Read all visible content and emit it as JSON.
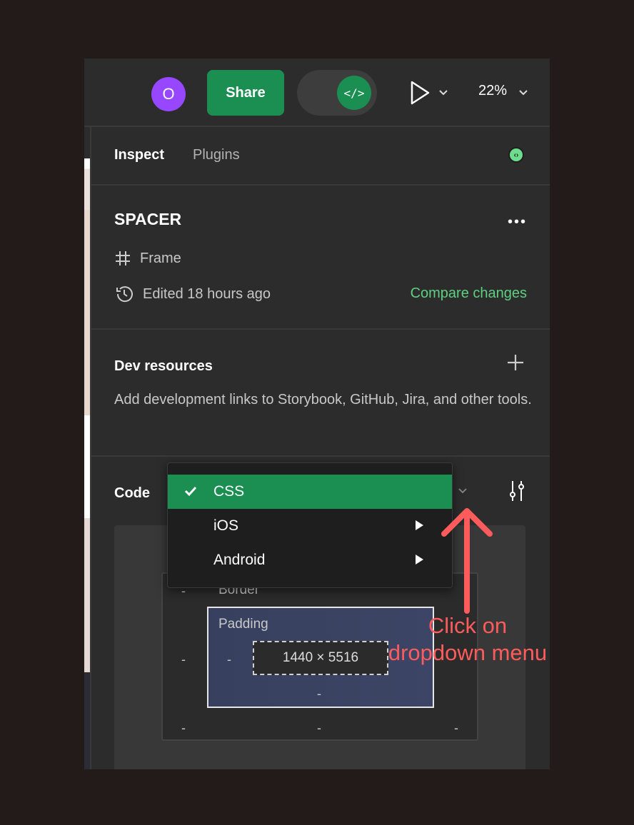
{
  "toolbar": {
    "avatar_initial": "O",
    "avatar_color": "#9747ff",
    "share_label": "Share",
    "dev_mode_icon": "code-icon",
    "dev_mode_glyph": "</>",
    "present_icon": "play-icon",
    "zoom_label": "22%"
  },
  "tabs": [
    {
      "label": "Inspect",
      "active": true
    },
    {
      "label": "Plugins",
      "active": false
    }
  ],
  "status_icon": "dev-status-icon",
  "layer": {
    "name": "SPACER",
    "more_icon": "more-icon",
    "type_icon": "frame-icon",
    "type_label": "Frame",
    "history_icon": "history-icon",
    "edited_label": "Edited 18 hours ago",
    "compare_label": "Compare changes"
  },
  "dev_resources": {
    "title": "Dev resources",
    "add_icon": "plus-icon",
    "description": "Add development links to Storybook, GitHub, Jira, and other tools."
  },
  "code": {
    "title": "Code",
    "selected_language": "CSS",
    "settings_icon": "settings-sliders-icon",
    "box_model": {
      "border_label": "Border",
      "padding_label": "Padding",
      "content_size": "1440 × 5516",
      "placeholder": "-",
      "box_sizing": "border-box"
    }
  },
  "language_menu": {
    "items": [
      {
        "label": "CSS",
        "selected": true,
        "has_submenu": false
      },
      {
        "label": "iOS",
        "selected": false,
        "has_submenu": true
      },
      {
        "label": "Android",
        "selected": false,
        "has_submenu": true
      }
    ]
  },
  "annotation": {
    "text_line1": "Click on",
    "text_line2": "dropdown menu",
    "color": "#fe5c5c"
  },
  "colors": {
    "accent_green": "#1b8f52",
    "link_green": "#5fcf80",
    "panel_bg": "#2c2c2c"
  }
}
